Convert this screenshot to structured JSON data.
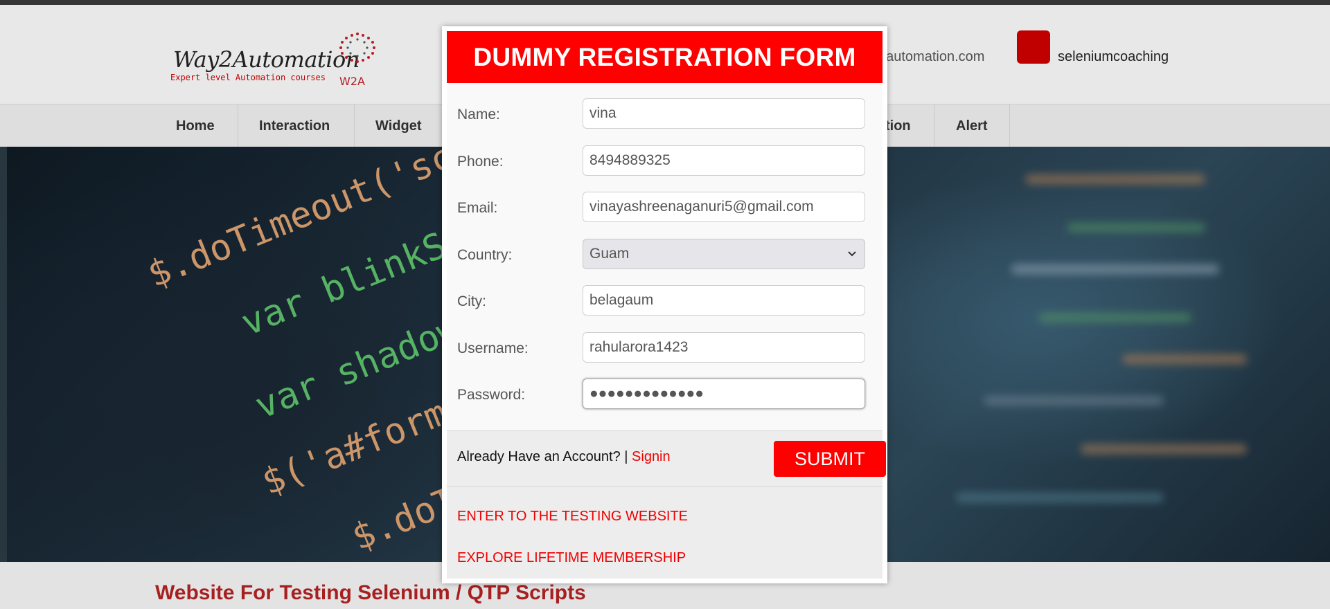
{
  "header": {
    "logo_title": "Way2Automation",
    "logo_subtitle": "Expert level Automation courses",
    "logo_mark": "W2A",
    "contact_email_partial": "2automation.com",
    "contact_skype": "seleniumcoaching"
  },
  "nav": {
    "items": [
      {
        "label": "Home"
      },
      {
        "label": "Interaction"
      },
      {
        "label": "Widget"
      },
      {
        "label": "tion"
      },
      {
        "label": "Alert"
      }
    ]
  },
  "hero": {
    "code_lines": [
      "$.doTimeout('scr",
      "var blinkSp",
      "var shadow",
      "$('a#form_",
      "$.doT"
    ]
  },
  "footer": {
    "title": "Website For Testing Selenium / QTP Scripts"
  },
  "modal": {
    "title": "DUMMY REGISTRATION FORM",
    "fields": {
      "name": {
        "label": "Name:",
        "value": "vina"
      },
      "phone": {
        "label": "Phone:",
        "value": "8494889325"
      },
      "email": {
        "label": "Email:",
        "value": "vinayashreenaganuri5@gmail.com"
      },
      "country": {
        "label": "Country:",
        "value": "Guam"
      },
      "city": {
        "label": "City:",
        "value": "belagaum"
      },
      "username": {
        "label": "Username:",
        "value": "rahularora1423"
      },
      "password": {
        "label": "Password:",
        "value": "●●●●●●●●●●●●●"
      }
    },
    "account_text": "Already Have an Account? |",
    "signin_label": "Signin",
    "submit_label": "SUBMIT",
    "links": {
      "enter": "ENTER TO THE TESTING WEBSITE",
      "membership": "EXPLORE LIFETIME MEMBERSHIP"
    }
  },
  "colors": {
    "accent": "#ff0000",
    "footer_title": "#b22222"
  }
}
